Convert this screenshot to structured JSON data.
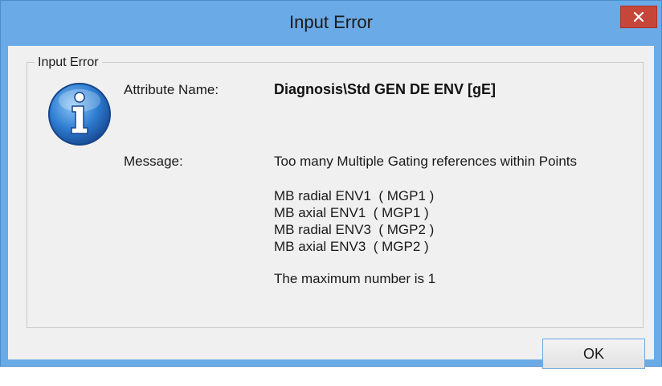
{
  "window": {
    "title": "Input Error",
    "close_icon": "close-icon"
  },
  "group": {
    "legend": "Input Error",
    "icon": "info-icon"
  },
  "fields": {
    "attribute_label": "Attribute Name:",
    "attribute_value": "Diagnosis\\Std GEN DE ENV [gE]",
    "message_label": "Message:",
    "message_text": "Too many Multiple Gating references within Points"
  },
  "references": [
    "MB radial ENV1  ( MGP1 )",
    "MB axial ENV1  ( MGP1 )",
    "MB radial ENV3  ( MGP2 )",
    "MB axial ENV3  ( MGP2 )"
  ],
  "max_text": "The maximum number is 1",
  "buttons": {
    "ok_label": "OK"
  },
  "colors": {
    "titlebar": "#6aaae6",
    "close_button": "#c7463a",
    "client": "#f0f0f0"
  }
}
